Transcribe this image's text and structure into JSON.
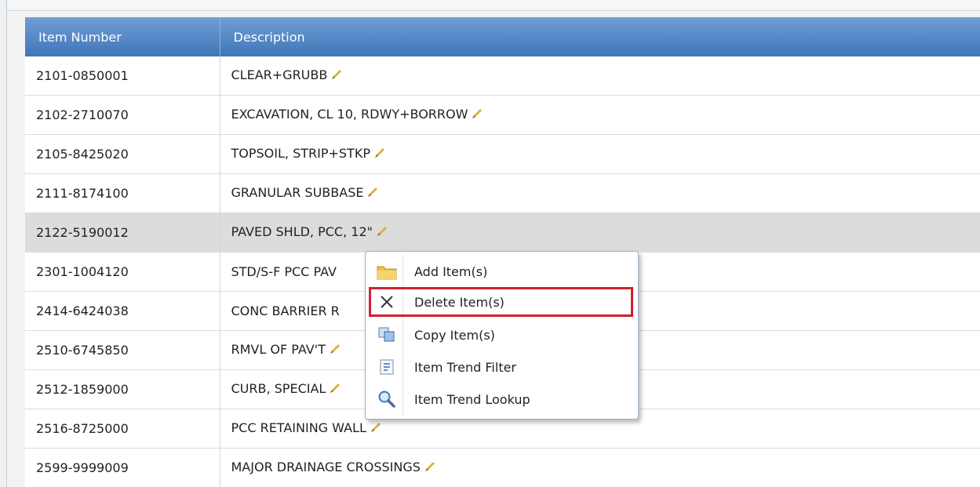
{
  "columns": {
    "item_number": "Item Number",
    "description": "Description"
  },
  "rows": [
    {
      "item": "2101-0850001",
      "desc": "CLEAR+GRUBB"
    },
    {
      "item": "2102-2710070",
      "desc": "EXCAVATION, CL 10, RDWY+BORROW"
    },
    {
      "item": "2105-8425020",
      "desc": "TOPSOIL, STRIP+STKP"
    },
    {
      "item": "2111-8174100",
      "desc": "GRANULAR SUBBASE"
    },
    {
      "item": "2122-5190012",
      "desc": "PAVED SHLD, PCC, 12\""
    },
    {
      "item": "2301-1004120",
      "desc": "STD/S-F PCC PAV"
    },
    {
      "item": "2414-6424038",
      "desc": "CONC BARRIER R"
    },
    {
      "item": "2510-6745850",
      "desc": "RMVL OF PAV'T"
    },
    {
      "item": "2512-1859000",
      "desc": "CURB, SPECIAL"
    },
    {
      "item": "2516-8725000",
      "desc": "PCC RETAINING WALL"
    },
    {
      "item": "2599-9999009",
      "desc": "MAJOR DRAINAGE CROSSINGS"
    }
  ],
  "context_menu": {
    "items": [
      {
        "label": "Add Item(s)",
        "icon": "folder-icon"
      },
      {
        "label": "Delete Item(s)",
        "icon": "close-icon"
      },
      {
        "label": "Copy Item(s)",
        "icon": "copy-icon"
      },
      {
        "label": "Item Trend Filter",
        "icon": "filter-icon"
      },
      {
        "label": "Item Trend Lookup",
        "icon": "magnifier-icon"
      }
    ]
  },
  "colors": {
    "header": "#4a81c2",
    "selected_row": "#dcdcdc",
    "highlight": "#d02030",
    "pencil": "#d4b030"
  }
}
